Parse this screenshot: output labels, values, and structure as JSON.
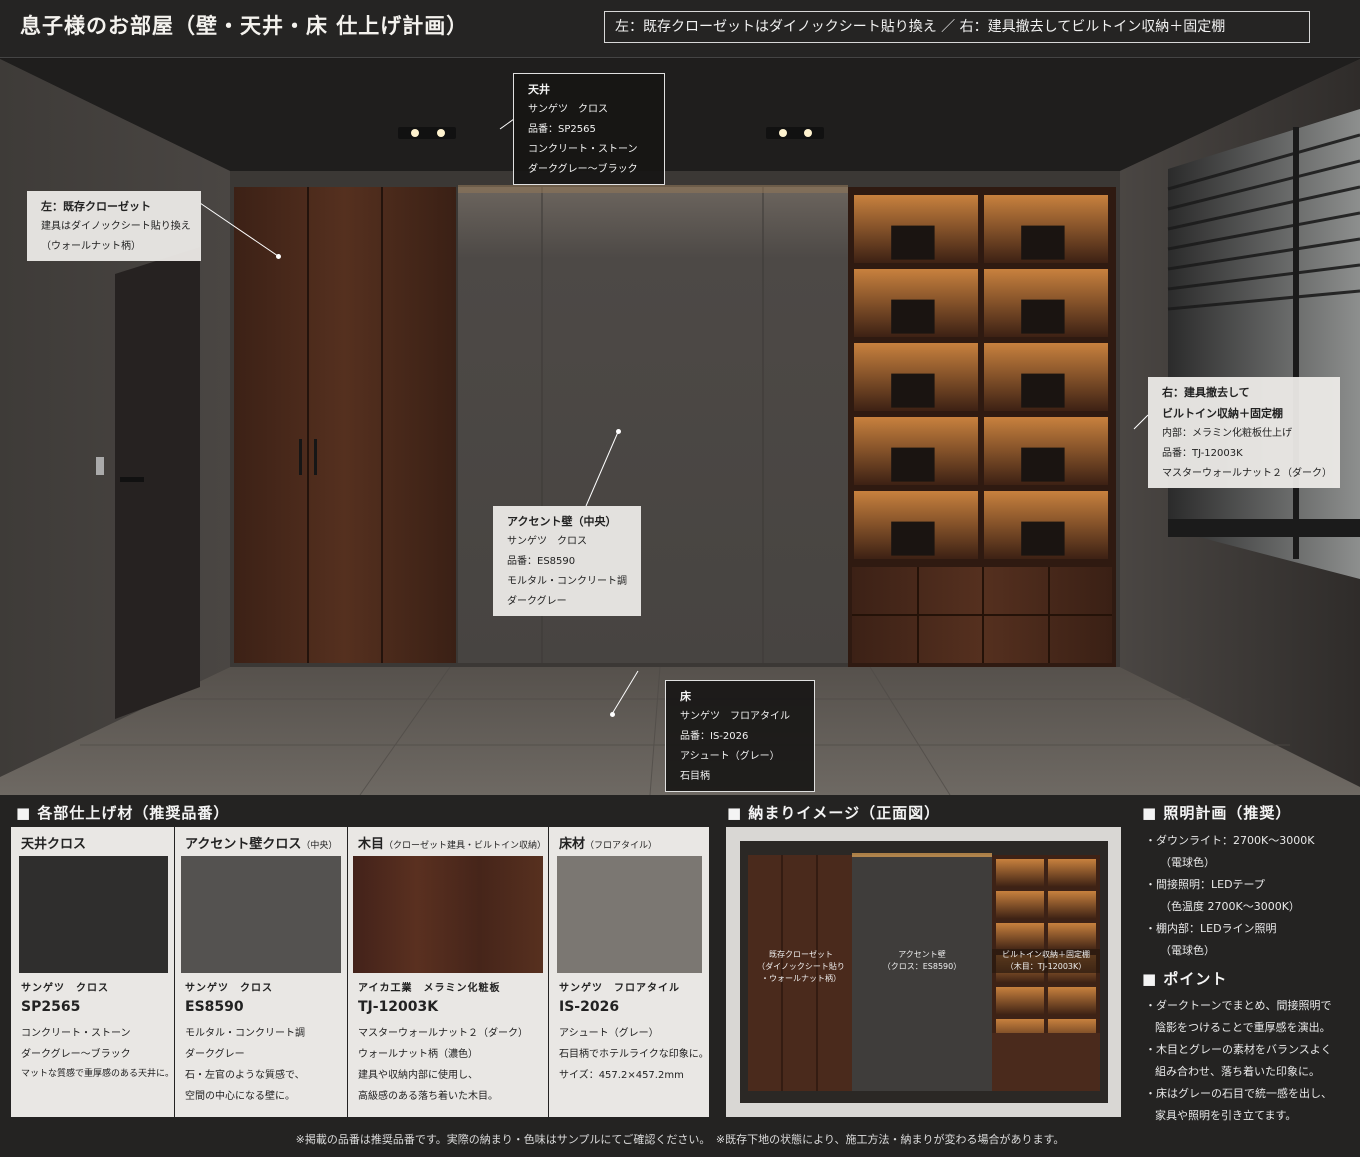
{
  "header": {
    "title": "息子様のお部屋（壁・天井・床 仕上げ計画）",
    "subtitle": "左：既存クローゼットはダイノックシート貼り換え ／ 右：建具撤去してビルトイン収納＋固定棚"
  },
  "callouts": {
    "ceiling": {
      "title": "天井",
      "lines": [
        "サンゲツ　クロス",
        "品番：SP2565",
        "コンクリート・ストーン",
        "ダークグレー〜ブラック"
      ]
    },
    "closet": {
      "title": "左：既存クローゼット",
      "lines": [
        "建具はダイノックシート貼り換え",
        "（ウォールナット柄）"
      ]
    },
    "accent": {
      "title": "アクセント壁（中央）",
      "lines": [
        "サンゲツ　クロス",
        "品番：ES8590",
        "モルタル・コンクリート調",
        "ダークグレー"
      ]
    },
    "builtin": {
      "title": "右：建具撤去して",
      "title2": "ビルトイン収納＋固定棚",
      "lines": [
        "内部：メラミン化粧板仕上げ",
        "品番：TJ-12003K",
        "マスターウォールナット２（ダーク）"
      ]
    },
    "floor": {
      "title": "床",
      "lines": [
        "サンゲツ　フロアタイル",
        "品番：IS-2026",
        "アシュート（グレー）",
        "石目柄"
      ]
    }
  },
  "materials": {
    "section_title": "■ 各部仕上げ材（推奨品番）",
    "cards": [
      {
        "head": "天井クロス",
        "head_small": "",
        "maker": "サンゲツ　クロス",
        "code": "SP2565",
        "lines": [
          "コンクリート・ストーン",
          "ダークグレー〜ブラック",
          "マットな質感で重厚感のある天井に。"
        ],
        "swatch": "#2f2e2d"
      },
      {
        "head": "アクセント壁クロス",
        "head_small": "（中央）",
        "maker": "サンゲツ　クロス",
        "code": "ES8590",
        "lines": [
          "モルタル・コンクリート調",
          "ダークグレー",
          "石・左官のような質感で、",
          "空間の中心になる壁に。"
        ],
        "swatch": "#545250"
      },
      {
        "head": "木目",
        "head_small": "（クローゼット建具・ビルトイン収納）",
        "maker": "アイカ工業　メラミン化粧板",
        "code": "TJ-12003K",
        "lines": [
          "マスターウォールナット２（ダーク）",
          "ウォールナット柄（濃色）",
          "建具や収納内部に使用し、",
          "高級感のある落ち着いた木目。"
        ],
        "swatch": "#4e2a1c"
      },
      {
        "head": "床材",
        "head_small": "（フロアタイル）",
        "maker": "サンゲツ　フロアタイル",
        "code": "IS-2026",
        "lines": [
          "アシュート（グレー）",
          "石目柄でホテルライクな印象に。",
          "サイズ：457.2×457.2mm"
        ],
        "swatch": "#7b7772"
      }
    ]
  },
  "elevation": {
    "section_title": "■ 納まりイメージ（正面図）",
    "closet": {
      "l1": "既存クローゼット",
      "l2": "（ダイノックシート貼り",
      "l3": "・ウォールナット柄）"
    },
    "accent": {
      "l1": "アクセント壁",
      "l2": "（クロス：ES8590）"
    },
    "builtin": {
      "l1": "ビルトイン収納＋固定棚",
      "l2": "（木目：TJ-12003K）"
    }
  },
  "lighting": {
    "section_title": "■ 照明計画（推奨）",
    "lines": [
      "・ダウンライト：2700K〜3000K",
      "（電球色）",
      "・間接照明：LEDテープ",
      "（色温度 2700K〜3000K）",
      "・棚内部：LEDライン照明",
      "（電球色）"
    ]
  },
  "points": {
    "section_title": "■ ポイント",
    "lines": [
      "・ダークトーンでまとめ、間接照明で",
      "陰影をつけることで重厚感を演出。",
      "・木目とグレーの素材をバランスよく",
      "組み合わせ、落ち着いた印象に。",
      "・床はグレーの石目で統一感を出し、",
      "家具や照明を引き立てます。"
    ]
  },
  "footer": "※掲載の品番は推奨品番です。実際の納まり・色味はサンプルにてご確認ください。　※既存下地の状態により、施工方法・納まりが変わる場合があります。",
  "colors": {
    "accent_wall": "#4b4947",
    "walnut": "#4a2a1c",
    "floor": "#6f6a64",
    "ceiling": "#1c1b1a",
    "led": "#ffb15a"
  }
}
